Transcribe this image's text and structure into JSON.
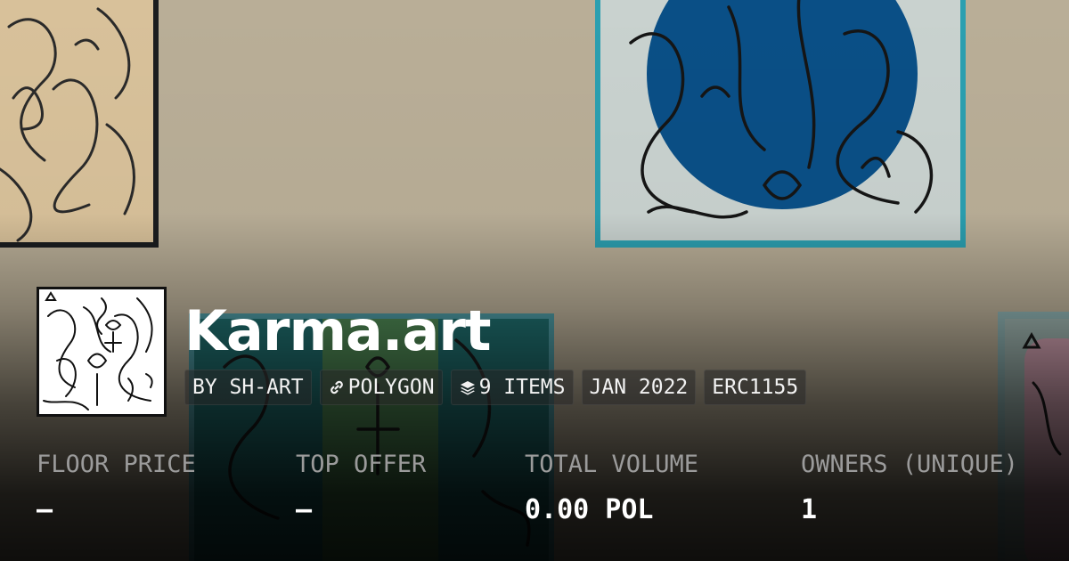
{
  "collection": {
    "title": "Karma.art",
    "chips": [
      {
        "label": "BY SH-ART",
        "icon": null
      },
      {
        "label": "POLYGON",
        "icon": "link-icon"
      },
      {
        "label": "9 ITEMS",
        "icon": "layers-icon"
      },
      {
        "label": "JAN 2022",
        "icon": null
      },
      {
        "label": "ERC1155",
        "icon": null
      }
    ]
  },
  "stats": [
    {
      "label": "FLOOR PRICE",
      "value": "–"
    },
    {
      "label": "TOP OFFER",
      "value": "–"
    },
    {
      "label": "TOTAL VOLUME",
      "value": "0.00 POL"
    },
    {
      "label": "OWNERS (UNIQUE)",
      "value": "1"
    }
  ],
  "colors": {
    "wall": "#b9ae97",
    "frame_blue_circle": "#0a4f86",
    "frame_teal_border": "#2b9fb0"
  }
}
